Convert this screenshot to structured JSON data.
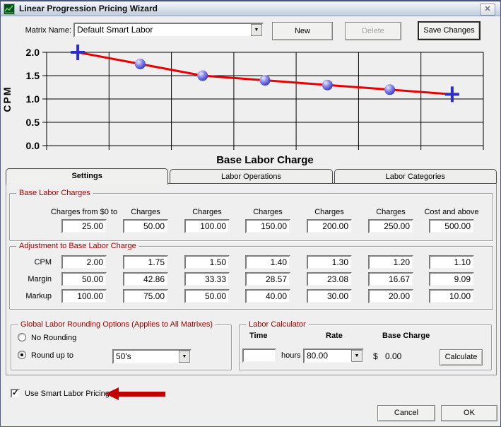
{
  "window": {
    "title": "Linear Progression Pricing Wizard"
  },
  "icons": {
    "close": "✕",
    "dropdown_arrow": "▼",
    "checkbox_check": "✓"
  },
  "toolbar": {
    "matrix_name_label": "Matrix Name:",
    "matrix_name_value": "Default Smart Labor",
    "new_label": "New",
    "delete_label": "Delete",
    "delete_enabled": false,
    "save_label": "Save Changes"
  },
  "chart_data": {
    "type": "line",
    "xlabel": "Base Labor Charge",
    "ylabel": "CPM",
    "categories": [
      "25.00",
      "50.00",
      "100.00",
      "150.00",
      "200.00",
      "250.00",
      "500.00"
    ],
    "values": [
      2.0,
      1.75,
      1.5,
      1.4,
      1.3,
      1.2,
      1.1
    ],
    "markers": [
      "cross",
      "sphere",
      "sphere",
      "sphere",
      "sphere",
      "sphere",
      "cross"
    ],
    "ylim": [
      0,
      2
    ],
    "yticks": [
      2.0,
      1.5,
      1.0,
      0.5,
      0.0
    ],
    "grid": true,
    "legend": "none",
    "line_color": "#e60000",
    "marker_color": "#4646d2",
    "cross_color": "#2d2dc8"
  },
  "tabs": [
    {
      "label": "Settings",
      "active": true
    },
    {
      "label": "Labor Operations",
      "active": false
    },
    {
      "label": "Labor Categories",
      "active": false
    }
  ],
  "base_labor_charges": {
    "title": "Base Labor Charges",
    "columns": [
      {
        "label": "Charges from $0 to",
        "value": "25.00"
      },
      {
        "label": "Charges",
        "value": "50.00"
      },
      {
        "label": "Charges",
        "value": "100.00"
      },
      {
        "label": "Charges",
        "value": "150.00"
      },
      {
        "label": "Charges",
        "value": "200.00"
      },
      {
        "label": "Charges",
        "value": "250.00"
      },
      {
        "label": "Cost and above",
        "value": "500.00"
      }
    ]
  },
  "adjustment": {
    "title": "Adjustment to Base Labor Charge",
    "rows": [
      {
        "label": "CPM",
        "values": [
          "2.00",
          "1.75",
          "1.50",
          "1.40",
          "1.30",
          "1.20",
          "1.10"
        ]
      },
      {
        "label": "Margin",
        "values": [
          "50.00",
          "42.86",
          "33.33",
          "28.57",
          "23.08",
          "16.67",
          "9.09"
        ]
      },
      {
        "label": "Markup",
        "values": [
          "100.00",
          "75.00",
          "50.00",
          "40.00",
          "30.00",
          "20.00",
          "10.00"
        ]
      }
    ]
  },
  "rounding": {
    "title": "Global Labor Rounding Options (Applies to All Matrixes)",
    "options": [
      {
        "label": "No Rounding",
        "selected": false
      },
      {
        "label": "Round up to",
        "selected": true
      }
    ],
    "round_to_value": "50's"
  },
  "calculator": {
    "title": "Labor Calculator",
    "time_header": "Time",
    "rate_header": "Rate",
    "base_charge_header": "Base Charge",
    "time_value": "",
    "hours_label": "hours",
    "rate_value": "80.00",
    "currency_symbol": "$",
    "base_charge_value": "0.00",
    "calculate_label": "Calculate"
  },
  "footer": {
    "smart_pricing_label": "Use Smart Labor Pricing",
    "smart_pricing_checked": true,
    "cancel_label": "Cancel",
    "ok_label": "OK"
  }
}
